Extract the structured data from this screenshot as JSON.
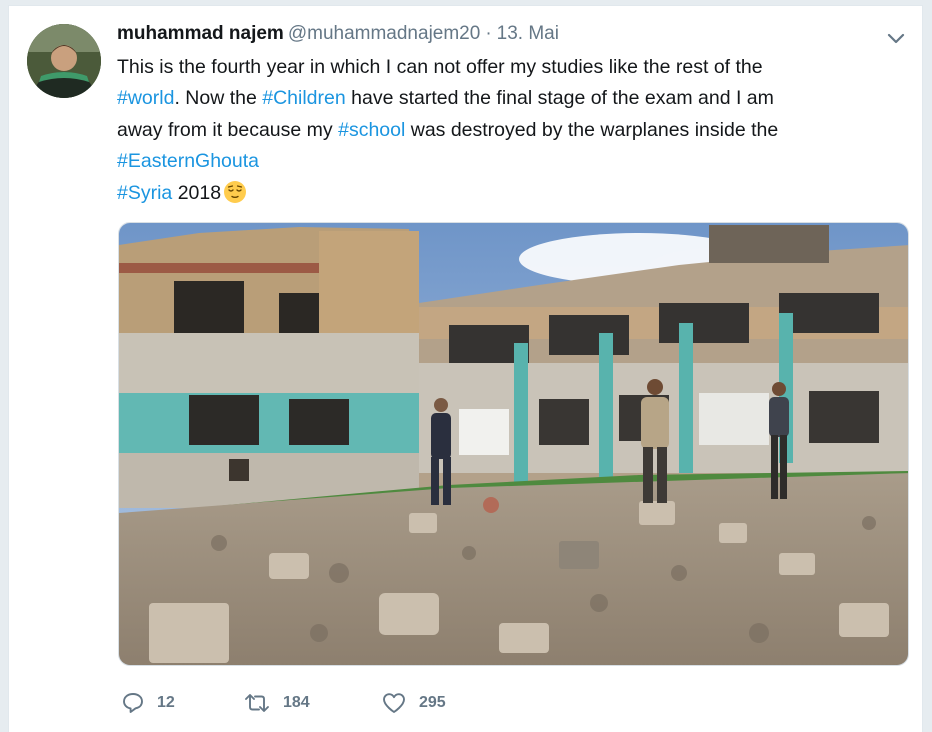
{
  "tweet": {
    "author": {
      "name": "muhammad najem",
      "handle": "@muhammadnajem20",
      "avatar_icon": "user-avatar"
    },
    "separator": "·",
    "date": "13. Mai",
    "menu_icon": "chevron-down-icon",
    "text": {
      "line1": "This is the fourth year in which I can not offer my studies like the rest of the",
      "line2_hashtag": "#world",
      "line2_text": ". Now the ",
      "line2_hashtag2": "#Children",
      "line2_text2": " have started the final stage of the exam and I am",
      "line3_text": "away from it because my ",
      "line3_hashtag": "#school",
      "line3_text2": " was destroyed by the warplanes inside the",
      "line4_hashtag": "#EasternGhouta",
      "line5_hashtag": "#Syria",
      "line5_text": " 2018",
      "emoji_icon": "relieved-face-emoji"
    },
    "media": {
      "icon": "photo-destroyed-school-courtyard"
    },
    "actions": {
      "reply_count": "12",
      "retweet_count": "184",
      "like_count": "295"
    },
    "colors": {
      "hashtag": "#1b95e0",
      "secondary_text": "#657786",
      "primary_text": "#14171a",
      "background": "#e6ecf0"
    }
  }
}
